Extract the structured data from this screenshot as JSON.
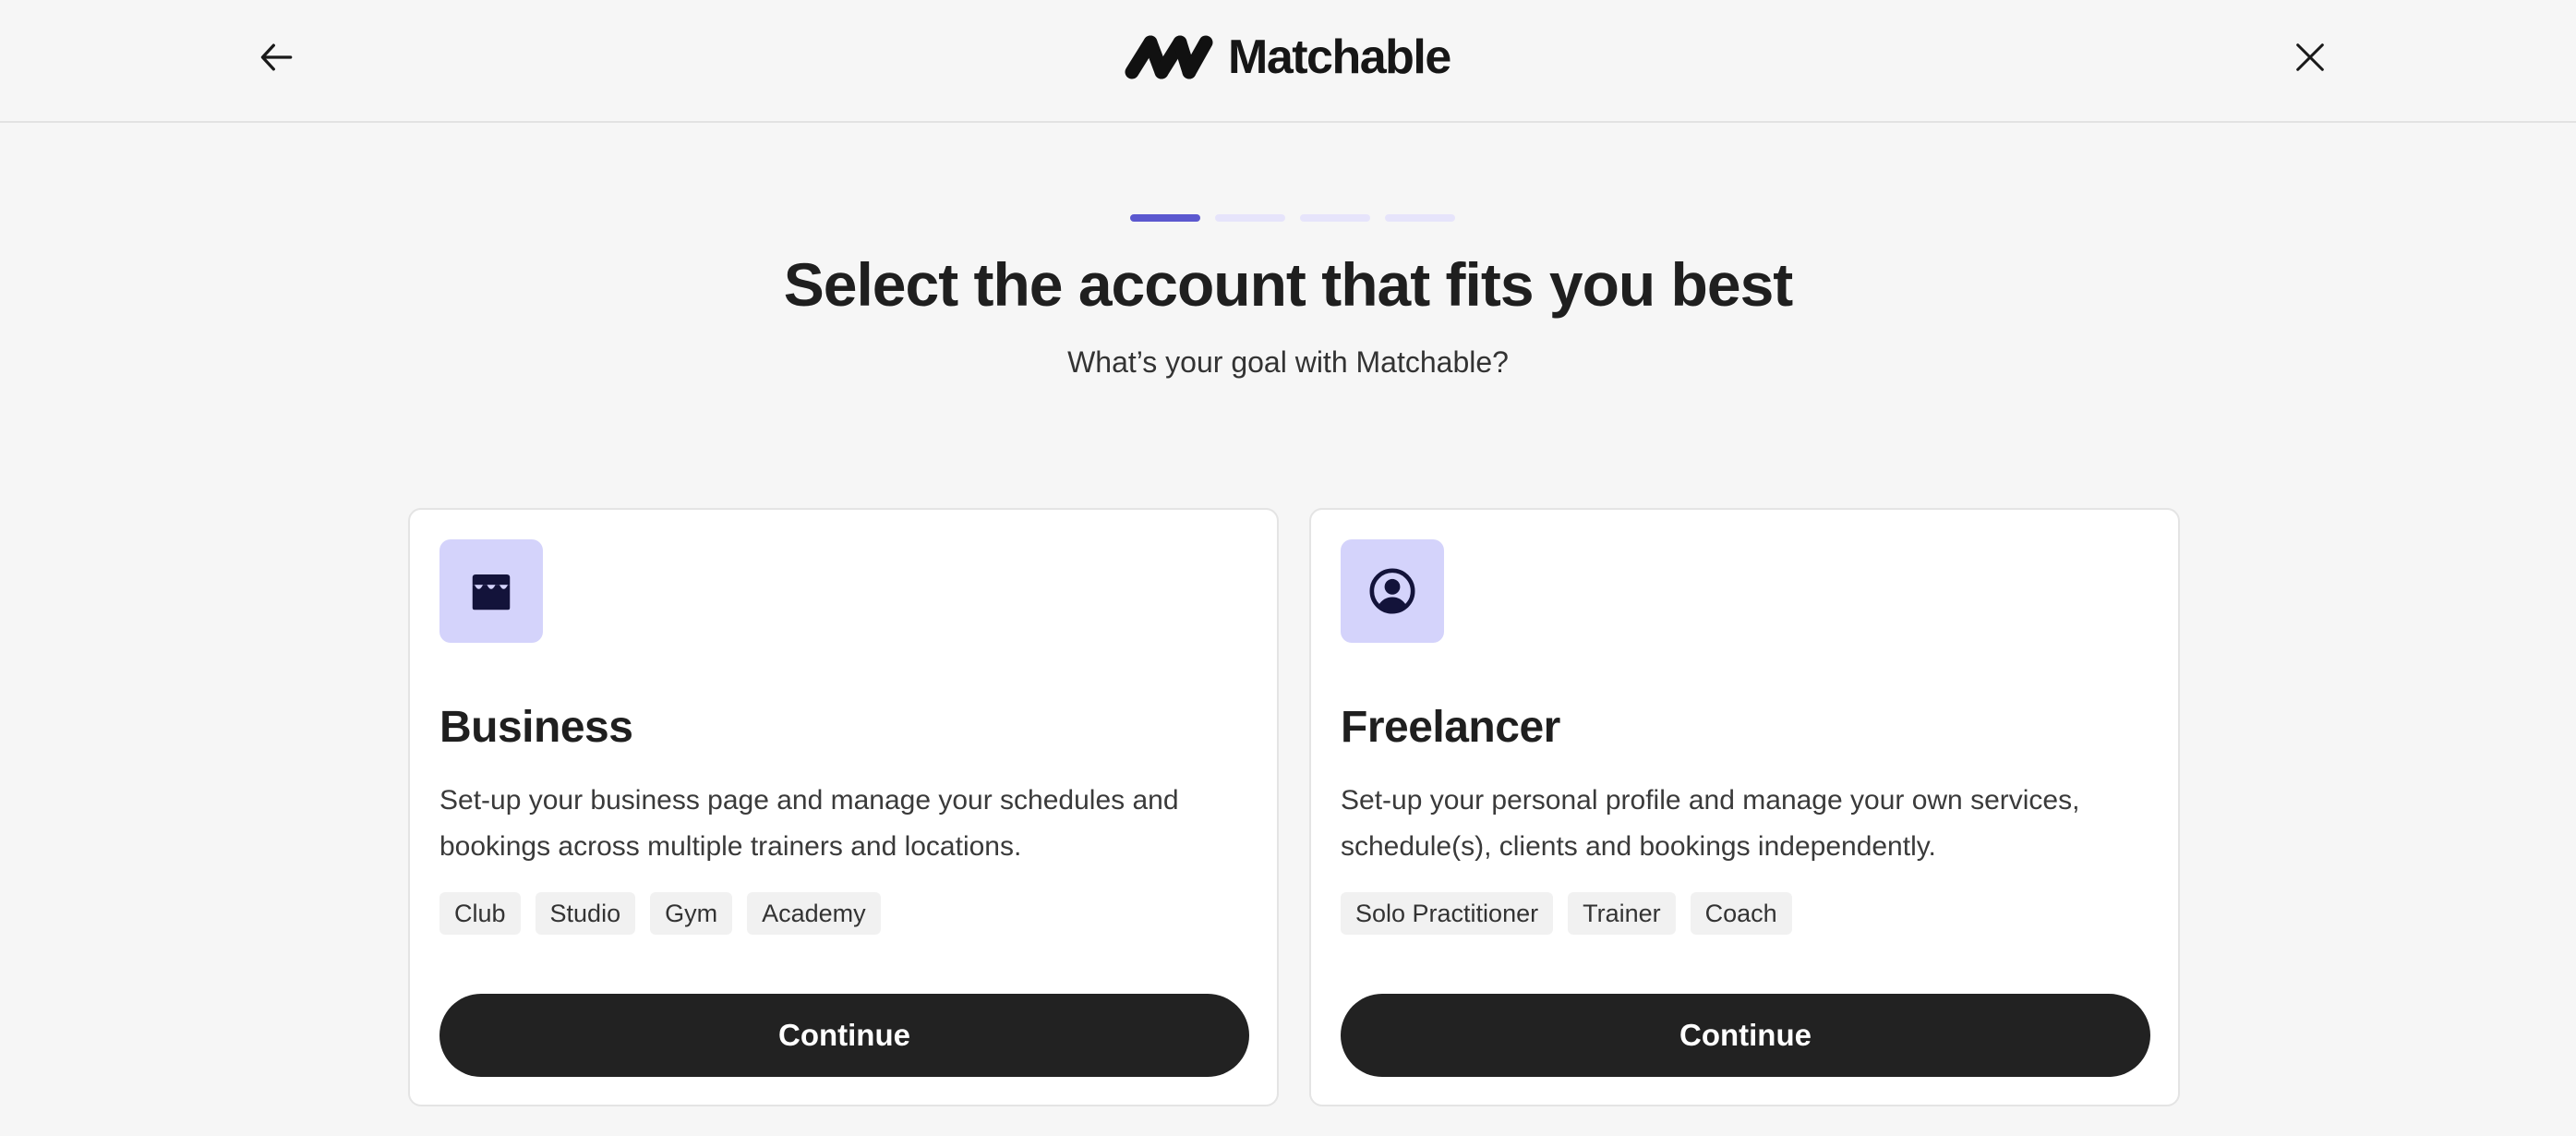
{
  "header": {
    "back_icon": "arrow-left-icon",
    "close_icon": "close-icon",
    "logo_text": "Matchable"
  },
  "progress": {
    "total_steps": 4,
    "current_step": 1
  },
  "main": {
    "title": "Select the account that fits you best",
    "subtitle": "What’s your goal with Matchable?"
  },
  "cards": [
    {
      "icon": "storefront-icon",
      "title": "Business",
      "description": "Set-up your business page and manage your schedules and bookings across multiple trainers and locations.",
      "tags": [
        "Club",
        "Studio",
        "Gym",
        "Academy"
      ],
      "button_label": "Continue"
    },
    {
      "icon": "user-circle-icon",
      "title": "Freelancer",
      "description": "Set-up your personal profile and manage your own services, schedule(s), clients and bookings independently.",
      "tags": [
        "Solo Practitioner",
        "Trainer",
        "Coach"
      ],
      "button_label": "Continue"
    }
  ],
  "colors": {
    "accent": "#5b58cf",
    "accent_light": "#e6e4fb",
    "icon_tile": "#d4d3fb",
    "button": "#222222",
    "background": "#f6f6f6"
  }
}
